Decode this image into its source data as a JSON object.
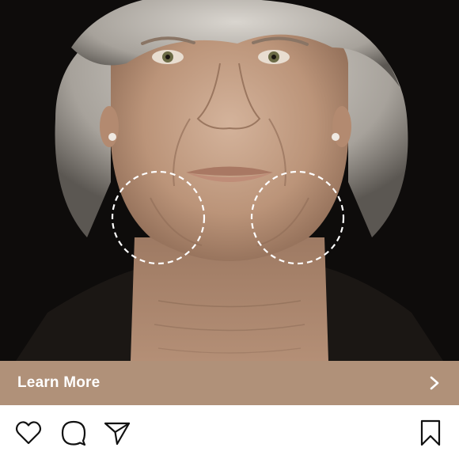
{
  "post": {
    "cta_label": "Learn More",
    "cta_bg": "#b09179",
    "icons": {
      "cta": "chevron-right-icon",
      "like": "heart-icon",
      "comment": "comment-bubble-icon",
      "share": "paper-plane-icon",
      "save": "bookmark-icon"
    }
  },
  "colors": {
    "background": "#0e0c0b",
    "skin": "#c9a58c",
    "hair": "#b9b4ad",
    "marker": "#ffffff"
  }
}
